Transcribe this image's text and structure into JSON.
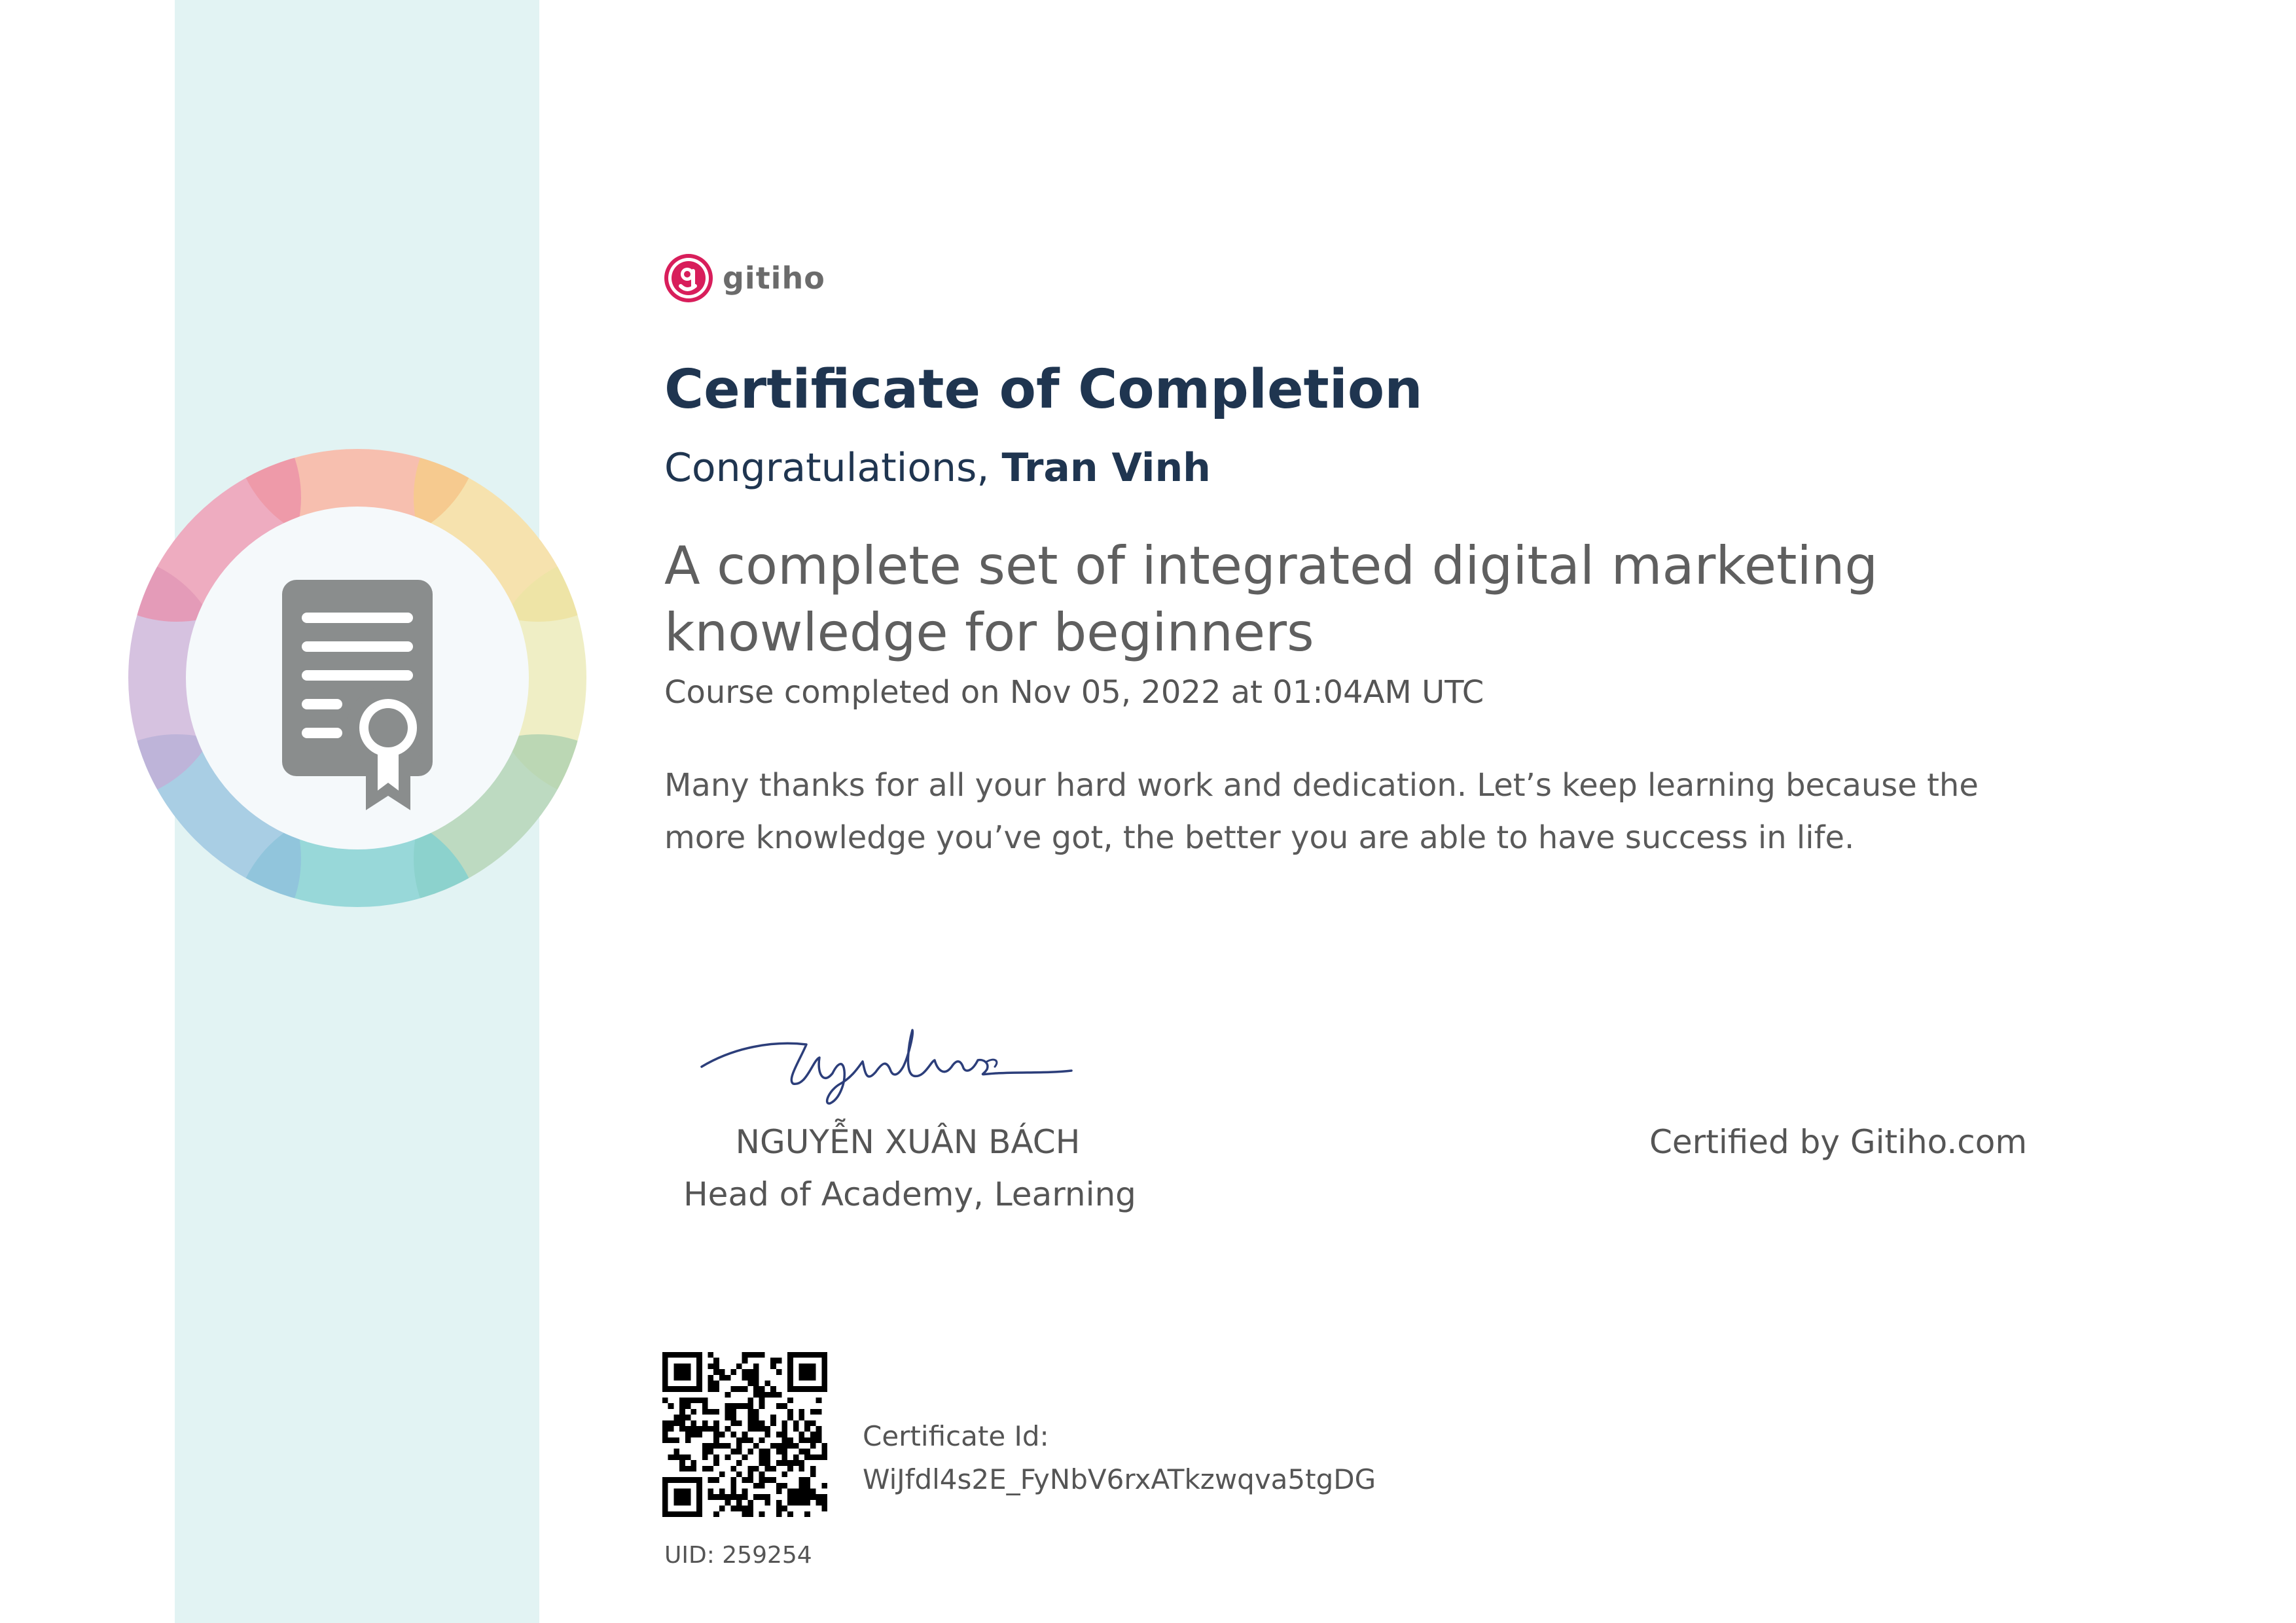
{
  "brand": {
    "logo_text": "gitiho",
    "accent_color": "#d81e5b"
  },
  "certificate": {
    "title": "Certificate of Completion",
    "congrats_prefix": "Congratulations, ",
    "recipient_name": "Tran Vinh",
    "course_title": "A complete set of integrated digital marketing knowledge for beginners",
    "completed_text": "Course completed on Nov 05, 2022 at 01:04AM UTC",
    "message": "Many thanks for all your hard work and dedication. Let’s keep learning because the more knowledge you’ve got, the better you are able to have success in life.",
    "title_color": "#1f3550"
  },
  "signatory": {
    "name": "NGUYỄN XUÂN BÁCH",
    "role": "Head of Academy, Learning",
    "signature_image": "handwritten-signature"
  },
  "certified_by": "Certified by Gitiho.com",
  "footer": {
    "qr_code": "qr-code",
    "certificate_id_label": "Certificate Id:",
    "certificate_id": "WiJfdl4s2E_FyNbV6rxATkzwqva5tgDG",
    "uid": "UID: 259254"
  },
  "emblem": {
    "icon": "certificate-document-icon",
    "band_color": "#e2f3f3"
  }
}
